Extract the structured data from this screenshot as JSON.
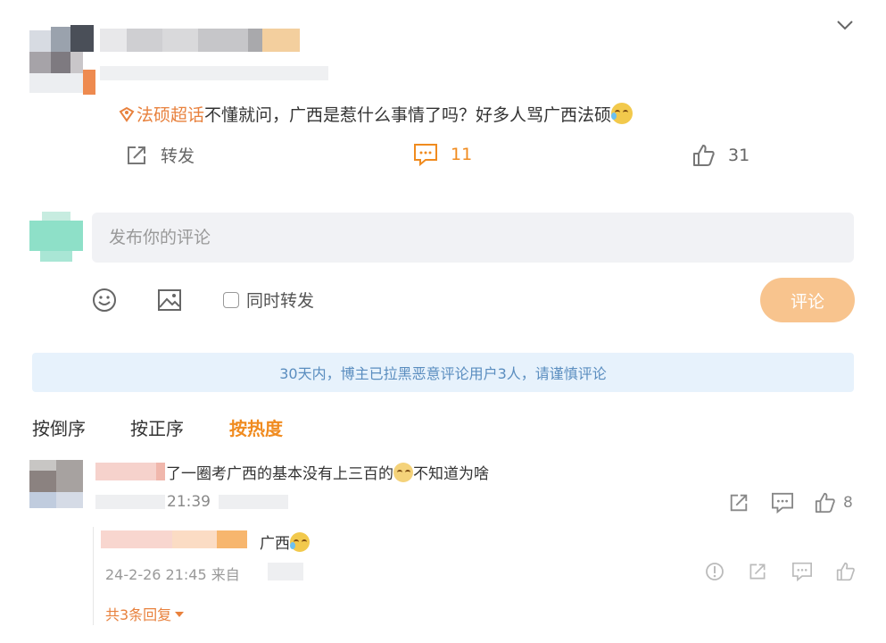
{
  "post": {
    "topic_label": "法硕超话",
    "text": "不懂就问，广西是惹什么事情了吗？好多人骂广西法硕",
    "actions": {
      "repost_label": "转发",
      "comment_count": "11",
      "like_count": "31"
    }
  },
  "comment_form": {
    "placeholder": "发布你的评论",
    "repost_checkbox_label": "同时转发",
    "submit_label": "评论"
  },
  "notice": "30天内，博主已拉黑恶意评论用户3人，请谨慎评论",
  "sort_tabs": [
    {
      "label": "按倒序"
    },
    {
      "label": "按正序"
    },
    {
      "label": "按热度",
      "active": true
    }
  ],
  "comments": [
    {
      "text_before": "了一圈考广西的基本没有上三百的",
      "text_after": "不知道为啥",
      "time": "21:39",
      "like_count": "8",
      "reply": {
        "text": "广西",
        "timestamp": "24-2-26 21:45",
        "source_prefix": "来自"
      },
      "more_replies_label": "共3条回复"
    }
  ],
  "colors": {
    "accent": "#f08b1f",
    "topic": "#e8813d",
    "notice_bg": "#e7f2fc",
    "notice_text": "#5a8dbf",
    "submit_bg": "#f8c48e"
  },
  "icons": [
    "chevron-down-icon",
    "topic-icon",
    "repost-icon",
    "comment-icon",
    "like-icon",
    "emoji-picker-icon",
    "image-icon",
    "report-icon",
    "emoji-crying-laughing",
    "emoji-dog"
  ]
}
